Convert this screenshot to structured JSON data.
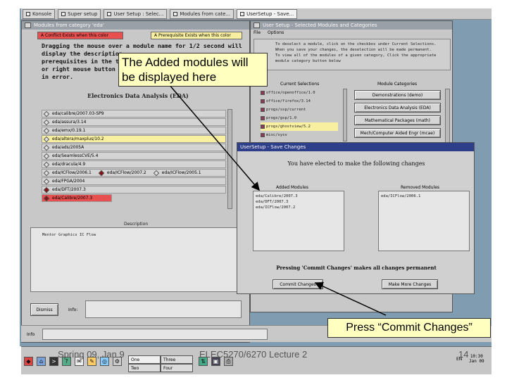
{
  "tabs": [
    {
      "label": "Konsole"
    },
    {
      "label": "Super setup"
    },
    {
      "label": "User Setup : Selec..."
    },
    {
      "label": "Modules from cate..."
    },
    {
      "label": "UserSetup - Save..."
    }
  ],
  "modules_window": {
    "title": "Modules from category 'eda'",
    "legend_conflict": "A Conflict Exists when this color",
    "legend_prereq": "A Prerequisite Exists when this color",
    "hint": "Dragging the mouse over a module name for 1/2 second will display the description ... prerequisites in the text ... or right mouse button to ... in error.",
    "hint_lines": [
      "Dragging the mouse over a module name for 1/2 second will",
      "display the description",
      "prerequisites in the text",
      "or right mouse button to",
      "in error."
    ],
    "category_heading": "Electronics Data Analysis (EDA)",
    "rows": [
      [
        "eda/calibre/2007.03-SP9"
      ],
      [
        "eda/assura/3.14"
      ],
      [
        "eda/emx/0.19.1"
      ],
      [
        "eda/altera/maxplus/10.2"
      ],
      [
        "eda/ads/2005A"
      ],
      [
        "eda/SeamlessCVE/5.4"
      ],
      [
        "eda/dracula/4.9"
      ],
      [
        "eda/ICFlow/2006.1",
        "eda/ICFlow/2007.2",
        "eda/ICFlow/2005.1"
      ],
      [
        "eda/FPGA/2004"
      ],
      [
        "eda/DFT/2007.3"
      ],
      [
        "eda/Calibre/2007.3"
      ]
    ],
    "description_label": "Description",
    "description_text": "Mentor Graphics IC Flow",
    "dismiss_label": "Dismiss",
    "info_label": "Info:"
  },
  "user_setup_window": {
    "title": "User Setup - Selected Modules and Categories",
    "menu_file": "File",
    "menu_options": "Options",
    "instructions": [
      "To deselect a module, click on the checkbox under Current Selections.",
      "When you save your changes, the deselection will be made permanent.",
      "To view all of the modules of a given category, Click the appropriate",
      "module category button below"
    ],
    "current_selections_heading": "Current Selections",
    "module_categories_heading": "Module Categories",
    "current_selections": [
      "office/openoffice/1.0",
      "office/firefox/3.14",
      "progs/ssp/current",
      "progs/gsp/1.0",
      "progs/ghostview/5.2",
      "misc/sysv"
    ],
    "categories": [
      "Demonstrations (demo)",
      "Electronics Data Analysis (EDA)",
      "Mathematical Packages (math)",
      "Mech/Computer Aided Engr (mcae)"
    ]
  },
  "save_window": {
    "title": "UserSetup - Save Changes",
    "heading": "You have elected to make the following changes",
    "added_heading": "Added Modules",
    "removed_heading": "Removed Modules",
    "added_modules": [
      "eda/Calibre/2007.3",
      "eda/DFT/2007.3",
      "eda/ICFlow/2007.2"
    ],
    "removed_modules": [
      "eda/ICFlow/2006.1"
    ],
    "notice": "Pressing 'Commit Changes' makes all changes permanent",
    "commit_button": "Commit Changes",
    "more_button": "Make More Changes"
  },
  "bottom_info": {
    "label": "Info"
  },
  "callouts": {
    "added": "The Added modules will be displayed here",
    "commit": "Press “Commit Changes”"
  },
  "footer": {
    "left": "Spring 09, Jan 9",
    "center": "ELEC5270/6270 Lecture 2",
    "page": "14"
  },
  "taskbar": {
    "pager": [
      "One",
      "Three",
      "Two",
      "Four"
    ],
    "clock": "10:30",
    "date": "Jan 09",
    "tray_label": "EN"
  },
  "colors": {
    "conflict": "#e85050",
    "prerequisite": "#f8f0a0",
    "selected_titlebar": "#2e3f8a",
    "desktop": "#7f9cb0",
    "callout_bg": "#ffffc0"
  }
}
